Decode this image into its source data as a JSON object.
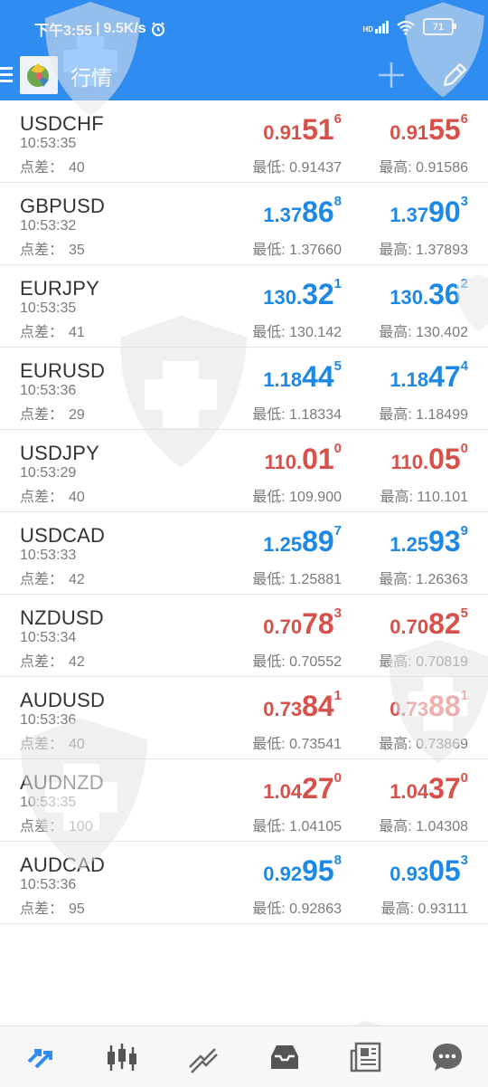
{
  "status_bar": {
    "time": "下午3:55",
    "net_speed": "9.5K/s",
    "signal_label": "HD",
    "battery": "71"
  },
  "app_bar": {
    "title": "行情",
    "icons": [
      "menu-icon",
      "app-logo-icon",
      "add-icon",
      "edit-icon"
    ]
  },
  "labels": {
    "spread": "点差：",
    "low": "最低:",
    "high": "最高:"
  },
  "colors": {
    "header_blue": "#2f8cf0",
    "price_red": "#d75049",
    "price_blue": "#1e88e5"
  },
  "quotes": [
    {
      "symbol": "USDCHF",
      "time": "10:53:35",
      "spread": "40",
      "color": "red",
      "bid": {
        "small": "0.91",
        "big": "51",
        "sup": "6"
      },
      "ask": {
        "small": "0.91",
        "big": "55",
        "sup": "6"
      },
      "low": "0.91437",
      "high": "0.91586"
    },
    {
      "symbol": "GBPUSD",
      "time": "10:53:32",
      "spread": "35",
      "color": "blue",
      "bid": {
        "small": "1.37",
        "big": "86",
        "sup": "8"
      },
      "ask": {
        "small": "1.37",
        "big": "90",
        "sup": "3"
      },
      "low": "1.37660",
      "high": "1.37893"
    },
    {
      "symbol": "EURJPY",
      "time": "10:53:35",
      "spread": "41",
      "color": "blue",
      "bid": {
        "small": "130.",
        "big": "32",
        "sup": "1"
      },
      "ask": {
        "small": "130.",
        "big": "36",
        "sup": "2"
      },
      "low": "130.142",
      "high": "130.402"
    },
    {
      "symbol": "EURUSD",
      "time": "10:53:36",
      "spread": "29",
      "color": "blue",
      "bid": {
        "small": "1.18",
        "big": "44",
        "sup": "5"
      },
      "ask": {
        "small": "1.18",
        "big": "47",
        "sup": "4"
      },
      "low": "1.18334",
      "high": "1.18499"
    },
    {
      "symbol": "USDJPY",
      "time": "10:53:29",
      "spread": "40",
      "color": "red",
      "bid": {
        "small": "110.",
        "big": "01",
        "sup": "0"
      },
      "ask": {
        "small": "110.",
        "big": "05",
        "sup": "0"
      },
      "low": "109.900",
      "high": "110.101"
    },
    {
      "symbol": "USDCAD",
      "time": "10:53:33",
      "spread": "42",
      "color": "blue",
      "bid": {
        "small": "1.25",
        "big": "89",
        "sup": "7"
      },
      "ask": {
        "small": "1.25",
        "big": "93",
        "sup": "9"
      },
      "low": "1.25881",
      "high": "1.26363"
    },
    {
      "symbol": "NZDUSD",
      "time": "10:53:34",
      "spread": "42",
      "color": "red",
      "bid": {
        "small": "0.70",
        "big": "78",
        "sup": "3"
      },
      "ask": {
        "small": "0.70",
        "big": "82",
        "sup": "5"
      },
      "low": "0.70552",
      "high": "0.70819"
    },
    {
      "symbol": "AUDUSD",
      "time": "10:53:36",
      "spread": "40",
      "color": "red",
      "bid": {
        "small": "0.73",
        "big": "84",
        "sup": "1"
      },
      "ask": {
        "small": "0.73",
        "big": "88",
        "sup": "1"
      },
      "low": "0.73541",
      "high": "0.73869"
    },
    {
      "symbol": "AUDNZD",
      "time": "10:53:35",
      "spread": "100",
      "color": "red",
      "bid": {
        "small": "1.04",
        "big": "27",
        "sup": "0"
      },
      "ask": {
        "small": "1.04",
        "big": "37",
        "sup": "0"
      },
      "low": "1.04105",
      "high": "1.04308"
    },
    {
      "symbol": "AUDCAD",
      "time": "10:53:36",
      "spread": "95",
      "color": "blue",
      "bid": {
        "small": "0.92",
        "big": "95",
        "sup": "8"
      },
      "ask": {
        "small": "0.93",
        "big": "05",
        "sup": "3"
      },
      "low": "0.92863",
      "high": "0.93111"
    }
  ],
  "bottom_nav": {
    "items": [
      "quotes-icon",
      "chart-icon",
      "trade-icon",
      "history-icon",
      "news-icon",
      "chat-icon"
    ]
  }
}
